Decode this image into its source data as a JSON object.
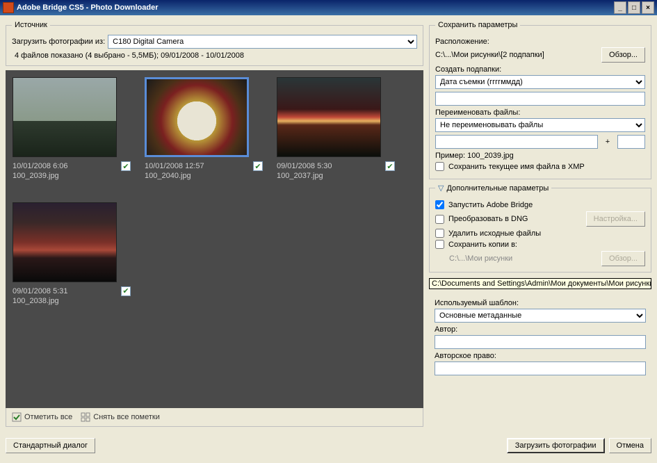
{
  "window": {
    "title": "Adobe Bridge CS5 - Photo Downloader"
  },
  "source": {
    "legend": "Источник",
    "load_from_label": "Загрузить фотографии из:",
    "device": "C180 Digital Camera",
    "status": "4 файлов показано (4 выбрано - 5,5МБ);  09/01/2008 - 10/01/2008"
  },
  "thumbs": [
    {
      "date": "10/01/2008 6:06",
      "file": "100_2039.jpg",
      "checked": true,
      "selected": false,
      "klass": "sky-fog"
    },
    {
      "date": "10/01/2008 12:57",
      "file": "100_2040.jpg",
      "checked": true,
      "selected": true,
      "klass": "bowl-fruit"
    },
    {
      "date": "09/01/2008 5:30",
      "file": "100_2037.jpg",
      "checked": true,
      "selected": false,
      "klass": "sunset-1"
    },
    {
      "date": "09/01/2008 5:31",
      "file": "100_2038.jpg",
      "checked": true,
      "selected": false,
      "klass": "sunset-2"
    }
  ],
  "thumbs_bar": {
    "check_all": "Отметить все",
    "uncheck_all": "Снять все пометки"
  },
  "save": {
    "legend": "Сохранить параметры",
    "location_label": "Расположение:",
    "location_path": "C:\\...\\Мои рисунки\\[2 подпапки]",
    "browse": "Обзор...",
    "subfolders_label": "Создать подпапки:",
    "subfolders_value": "Дата съемки (ггггммдд)",
    "rename_label": "Переименовать файлы:",
    "rename_value": "Не переименовывать файлы",
    "example_label": "Пример:",
    "example_value": "100_2039.jpg",
    "save_xmp": "Сохранить текущее имя файла в XMP"
  },
  "advanced": {
    "legend": "Дополнительные параметры",
    "launch_bridge": "Запустить Adobe Bridge",
    "convert_dng": "Преобразовать в DNG",
    "dng_settings": "Настройка...",
    "delete_originals": "Удалить исходные файлы",
    "save_copies": "Сохранить копии в:",
    "copies_path": "C:\\...\\Мои рисунки",
    "browse": "Обзор..."
  },
  "tooltip": "C:\\Documents and Settings\\Admin\\Мои документы\\Мои рисунки",
  "metadata": {
    "template_label": "Используемый шаблон:",
    "template_value": "Основные метаданные",
    "author_label": "Автор:",
    "author_value": "",
    "copyright_label": "Авторское право:",
    "copyright_value": ""
  },
  "footer": {
    "std_dialog": "Стандартный диалог",
    "download": "Загрузить фотографии",
    "cancel": "Отмена"
  }
}
